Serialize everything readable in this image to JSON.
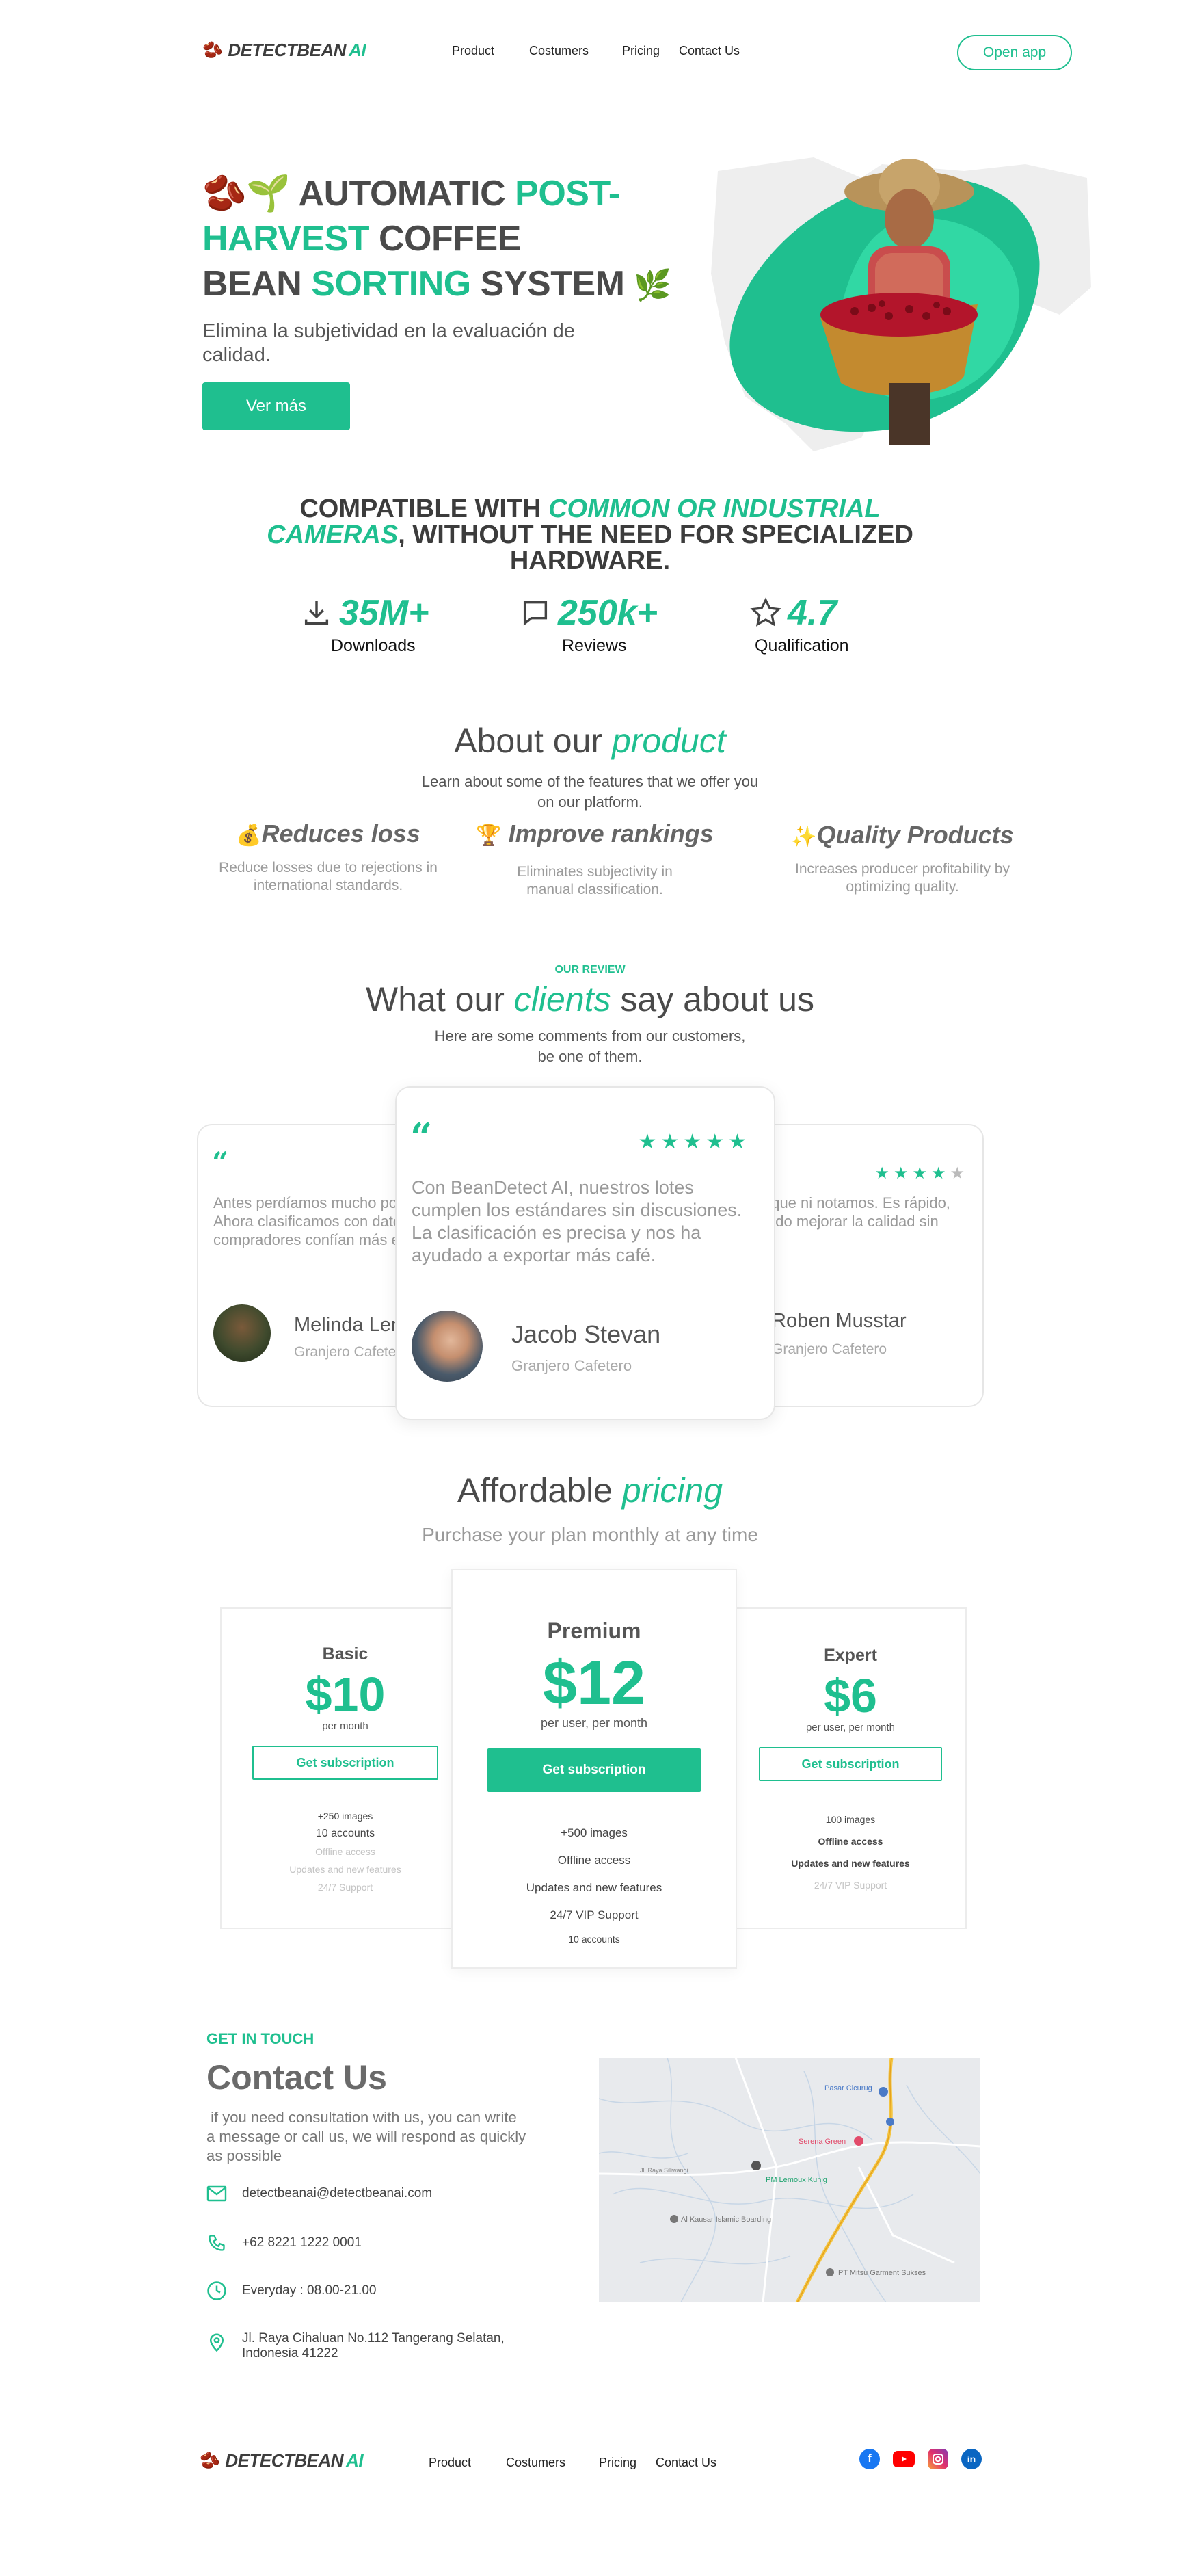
{
  "brand": {
    "name_main": "DETECTBEAN",
    "name_ai": "AI"
  },
  "nav": {
    "items": [
      "Product",
      "Costumers",
      "Pricing",
      "Contact Us"
    ],
    "cta": "Open app"
  },
  "hero": {
    "title_l1a": "AUTOMATIC ",
    "title_l1b": "POST-",
    "title_l2a": "HARVEST",
    "title_l2b": " COFFEE",
    "title_l3a": "BEAN ",
    "title_l3b": "SORTING",
    "title_l3c": " SYSTEM",
    "subtitle": "Elimina la subjetividad en la evaluación de calidad.",
    "button": "Ver más"
  },
  "compat": {
    "a": "COMPATIBLE WITH ",
    "b": "COMMON OR INDUSTRIAL",
    "c": "CAMERAS",
    ",d": "",
    "d": ", WITHOUT THE NEED FOR SPECIALIZED",
    "e": "HARDWARE."
  },
  "stats": [
    {
      "value": "35M+",
      "label": "Downloads",
      "icon": "download-icon"
    },
    {
      "value": "250k+",
      "label": "Reviews",
      "icon": "chat-bubble-icon"
    },
    {
      "value": "4.7",
      "label": "Qualification",
      "icon": "star-icon"
    }
  ],
  "about": {
    "title_a": "About our ",
    "title_b": "product",
    "subtitle": "Learn about some of the features that we offer you on our platform.",
    "features": [
      {
        "emoji": "💰",
        "title": "Reduces loss",
        "desc": "Reduce losses due to rejections in international standards."
      },
      {
        "emoji": "🏆",
        "title": "Improve rankings",
        "desc": "Eliminates subjectivity in manual classification."
      },
      {
        "emoji": "✨",
        "title": "Quality Products",
        "desc": "Increases producer profitability by optimizing quality."
      }
    ]
  },
  "reviews": {
    "eyebrow": "OUR REVIEW",
    "title_a": "What our ",
    "title_b": "clients",
    "title_c": " say about us",
    "subtitle_l1": "Here are some comments from our customers,",
    "subtitle_l2": "be one of them.",
    "left": {
      "text": "Antes perdíamos mucho por errores humanos. Ahora clasificamos con datos reales, y los compradores confían más en nuestro producto.",
      "name": "Melinda Lenon",
      "role": "Granjero Cafetero"
    },
    "center": {
      "text": "Con BeanDetect AI, nuestros lotes cumplen los estándares sin discusiones. La clasificación es precisa y nos ha ayudado a exportar más café.",
      "name": "Jacob Stevan",
      "role": "Granjero Cafetero",
      "stars": "★★★★★"
    },
    "right": {
      "text": "Detecta defectos que ni notamos. Es rápido, confiable y permitido mejorar la calidad sin equipos caros.",
      "name": "Roben Musstar",
      "role": "Granjero Cafetero",
      "stars": "★★★★"
    }
  },
  "pricing": {
    "title_a": "Affordable ",
    "title_b": "pricing",
    "subtitle": "Purchase your plan monthly at any time",
    "plans": [
      {
        "name": "Basic",
        "price": "$10",
        "per": "per month",
        "button": "Get subscription",
        "features": [
          "+250 images",
          "10 accounts",
          "Offline access",
          "Updates and new features",
          "24/7 Support"
        ]
      },
      {
        "name": "Premium",
        "price": "$12",
        "per": "per user, per month",
        "button": "Get subscription",
        "features": [
          "+500 images",
          "Offline access",
          "Updates and new features",
          "24/7 VIP Support",
          "10 accounts"
        ]
      },
      {
        "name": "Expert",
        "price": "$6",
        "per": "per user, per month",
        "button": "Get subscription",
        "features": [
          "100 images",
          "Offline access",
          "Updates and new features",
          "24/7 VIP Support"
        ]
      }
    ]
  },
  "contact": {
    "eyebrow": "GET IN TOUCH",
    "title": "Contact Us",
    "desc": " if you need consultation with us, you can write a message or call us, we will respond as quickly as possible",
    "email": "detectbeanai@detectbeanai.com",
    "phone": "+62 8221 1222 0001",
    "hours": "Everyday : 08.00-21.00",
    "address": "Jl. Raya Cihaluan No.112 Tangerang Selatan, Indonesia 41222",
    "map_labels": [
      "Pasar Cicurug",
      "Serena Green",
      "PM Lemoux Kunig",
      "Al Kausar Islamic Boarding",
      "PT Mitsu Garment Sukses",
      "Jl. Raya Siliwangi"
    ]
  },
  "footer": {
    "nav": [
      "Product",
      "Costumers",
      "Pricing",
      "Contact Us"
    ]
  },
  "colors": {
    "accent": "#1fbf8f",
    "text": "#4a4a4a"
  }
}
